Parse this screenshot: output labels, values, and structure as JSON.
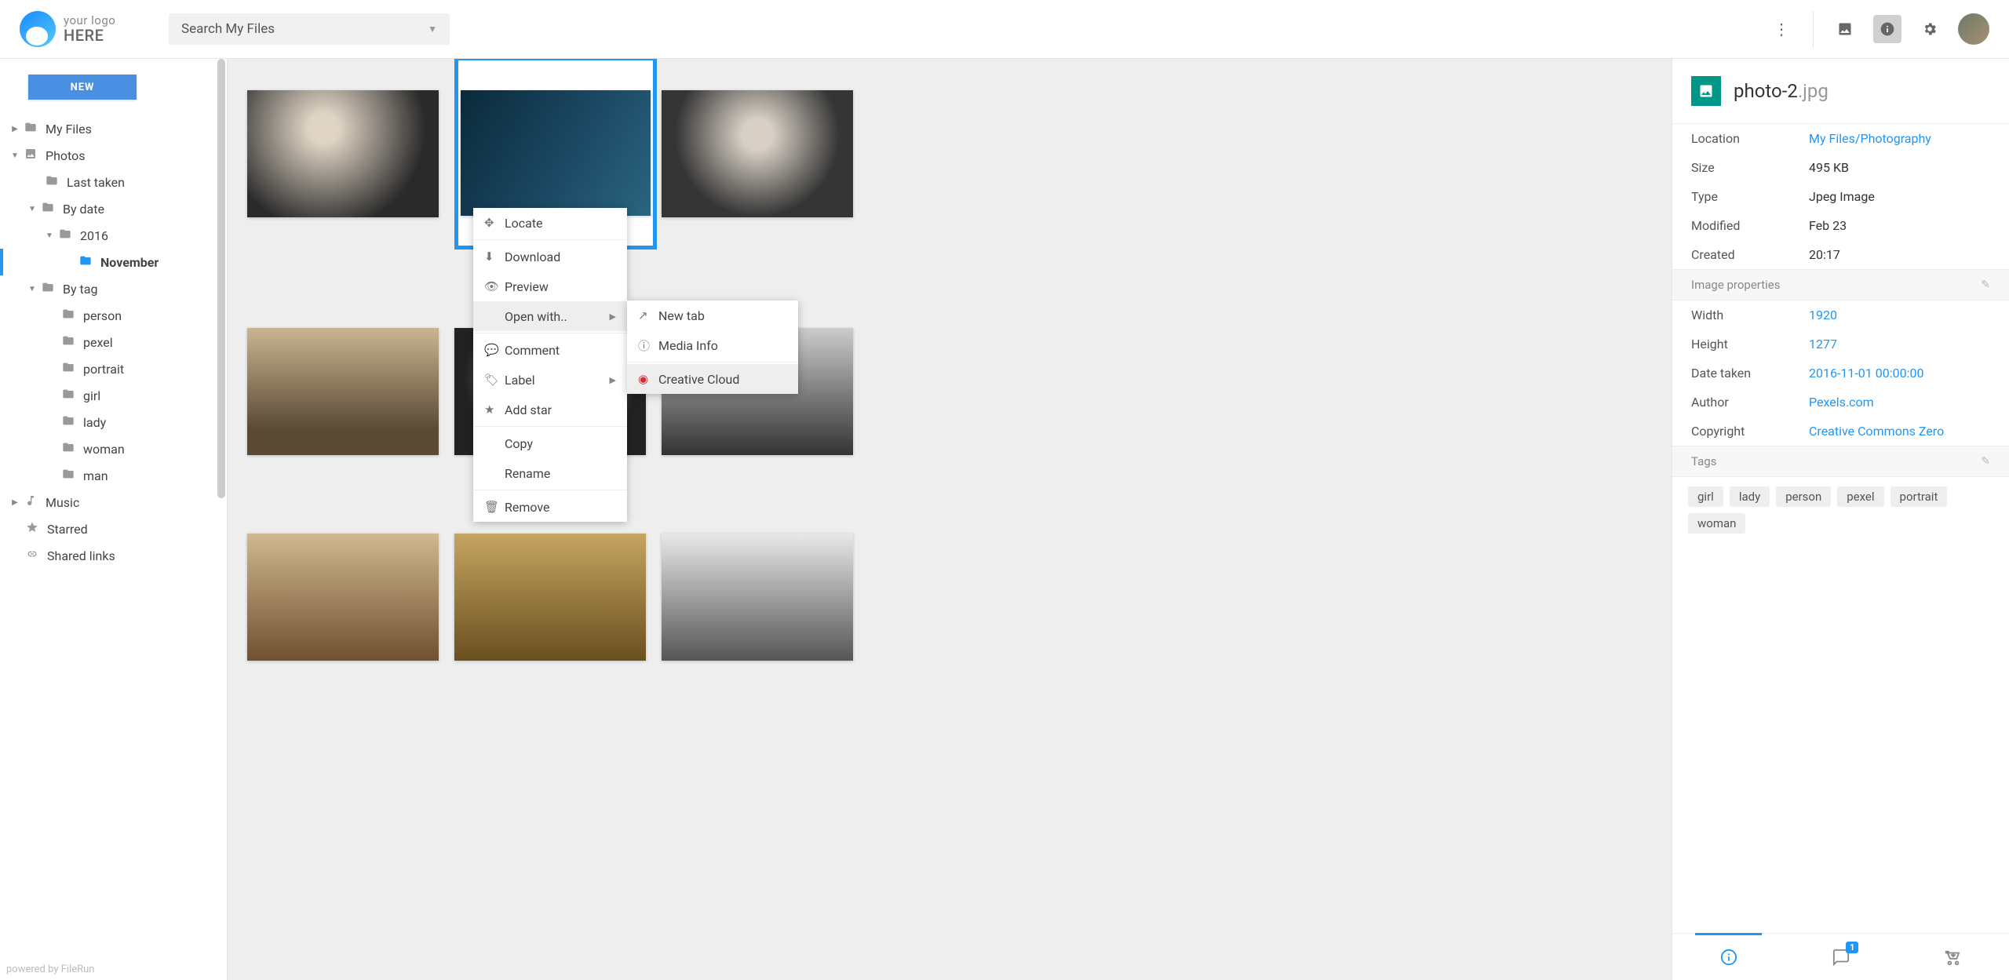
{
  "header": {
    "logo_top": "your logo",
    "logo_bottom": "HERE",
    "search_placeholder": "Search My Files"
  },
  "sidebar": {
    "new_label": "NEW",
    "tree": {
      "my_files": "My Files",
      "photos": "Photos",
      "last_taken": "Last taken",
      "by_date": "By date",
      "year_2016": "2016",
      "november": "November",
      "by_tag": "By tag",
      "tag_person": "person",
      "tag_pexel": "pexel",
      "tag_portrait": "portrait",
      "tag_girl": "girl",
      "tag_lady": "lady",
      "tag_woman": "woman",
      "tag_man": "man",
      "music": "Music",
      "starred": "Starred",
      "shared_links": "Shared links"
    },
    "powered": "powered by FileRun"
  },
  "context_menu": {
    "locate": "Locate",
    "download": "Download",
    "preview": "Preview",
    "open_with": "Open with..",
    "comment": "Comment",
    "label": "Label",
    "add_star": "Add star",
    "copy": "Copy",
    "rename": "Rename",
    "remove": "Remove"
  },
  "submenu": {
    "new_tab": "New tab",
    "media_info": "Media Info",
    "creative_cloud": "Creative Cloud"
  },
  "details": {
    "filename_base": "photo-2",
    "filename_ext": ".jpg",
    "rows": {
      "location_label": "Location",
      "location_value": "My Files/Photography",
      "size_label": "Size",
      "size_value": "495 KB",
      "type_label": "Type",
      "type_value": "Jpeg Image",
      "modified_label": "Modified",
      "modified_value": "Feb 23",
      "created_label": "Created",
      "created_value": "20:17"
    },
    "image_props_label": "Image properties",
    "image_props": {
      "width_label": "Width",
      "width_value": "1920",
      "height_label": "Height",
      "height_value": "1277",
      "date_taken_label": "Date taken",
      "date_taken_value": "2016-11-01 00:00:00",
      "author_label": "Author",
      "author_value": "Pexels.com",
      "copyright_label": "Copyright",
      "copyright_value": "Creative Commons Zero"
    },
    "tags_label": "Tags",
    "tags": [
      "girl",
      "lady",
      "person",
      "pexel",
      "portrait",
      "woman"
    ],
    "comment_badge": "1"
  }
}
